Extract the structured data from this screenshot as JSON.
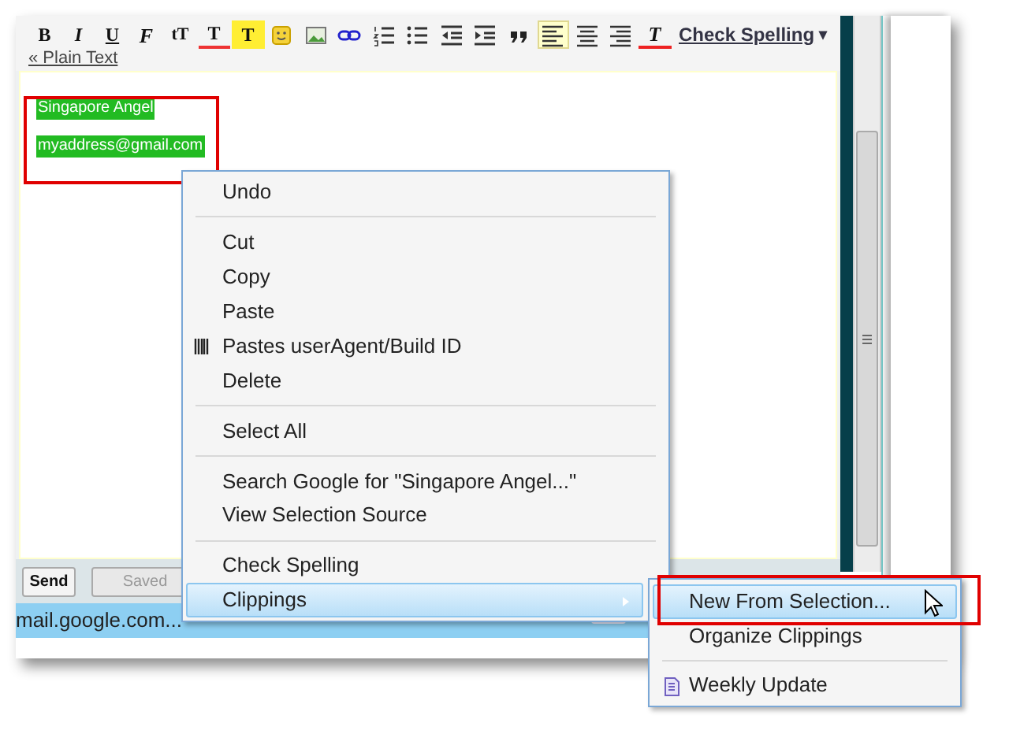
{
  "toolbar": {
    "buttons": [
      {
        "kind": "bold",
        "text": "B",
        "selected": false
      },
      {
        "kind": "italic",
        "text": "I",
        "selected": false
      },
      {
        "kind": "underline",
        "text": "U",
        "selected": false
      },
      {
        "kind": "font",
        "text": "F",
        "selected": false
      },
      {
        "kind": "size",
        "text": "tT",
        "selected": false
      },
      {
        "kind": "text-color",
        "text": "T",
        "selected": false
      },
      {
        "kind": "highlight",
        "text": "T",
        "selected": false
      },
      {
        "kind": "emoji",
        "selected": false
      },
      {
        "kind": "image",
        "selected": false
      },
      {
        "kind": "link",
        "selected": false
      },
      {
        "kind": "numbered-list",
        "selected": false
      },
      {
        "kind": "bulleted-list",
        "selected": false
      },
      {
        "kind": "outdent",
        "selected": false
      },
      {
        "kind": "indent",
        "selected": false
      },
      {
        "kind": "quote",
        "selected": false
      },
      {
        "kind": "align-left",
        "selected": true
      },
      {
        "kind": "align-center",
        "selected": false
      },
      {
        "kind": "align-right",
        "selected": false
      },
      {
        "kind": "remove-format",
        "text": "T",
        "selected": false
      }
    ],
    "check_spelling": {
      "label": "Check Spelling",
      "caret": "▾"
    },
    "plain_text_link": "« Plain Text"
  },
  "editor": {
    "lines": [
      "Singapore Angel",
      "myaddress@gmail.com"
    ]
  },
  "buttons": [
    {
      "label": "Send",
      "kind": "primary"
    },
    {
      "label": "Saved",
      "kind": "disabled"
    }
  ],
  "status_bar": {
    "text": "mail.google.com..."
  },
  "context_menu": {
    "items": [
      {
        "kind": "item",
        "label": "Undo",
        "highlighted": false
      },
      {
        "kind": "separator"
      },
      {
        "kind": "item",
        "label": "Cut",
        "highlighted": false
      },
      {
        "kind": "item",
        "label": "Copy",
        "highlighted": false
      },
      {
        "kind": "item",
        "label": "Paste",
        "highlighted": false
      },
      {
        "kind": "tool",
        "label": "Pastes userAgent/Build ID",
        "highlighted": false
      },
      {
        "kind": "item",
        "label": "Delete",
        "highlighted": false
      },
      {
        "kind": "separator"
      },
      {
        "kind": "item",
        "label": "Select All",
        "highlighted": false
      },
      {
        "kind": "separator"
      },
      {
        "kind": "item",
        "label": "Search Google for \"Singapore Angel...\"",
        "highlighted": false
      },
      {
        "kind": "item",
        "label": "View Selection Source",
        "highlighted": false
      },
      {
        "kind": "separator"
      },
      {
        "kind": "item",
        "label": "Check Spelling",
        "highlighted": false
      },
      {
        "kind": "submenu",
        "label": "Clippings",
        "highlighted": true
      }
    ]
  },
  "submenu": {
    "items": [
      {
        "kind": "item",
        "label": "New From Selection...",
        "highlighted": true
      },
      {
        "kind": "item",
        "label": "Organize Clippings",
        "highlighted": false
      },
      {
        "kind": "separator"
      },
      {
        "kind": "clipping",
        "label": "Weekly Update",
        "highlighted": false
      }
    ]
  }
}
